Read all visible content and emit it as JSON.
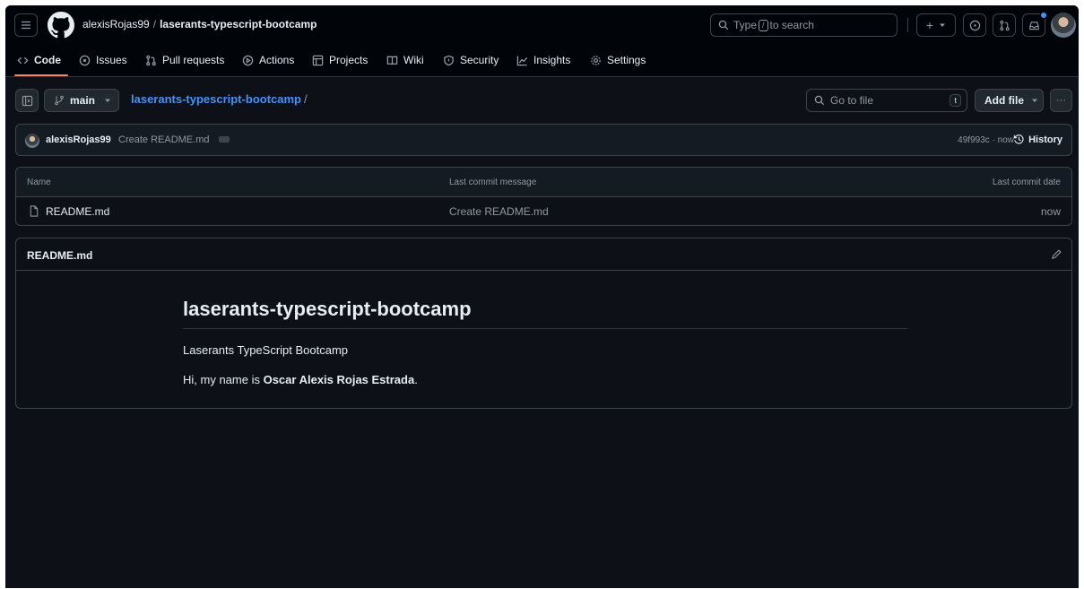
{
  "header": {
    "owner": "alexisRojas99",
    "separator": "/",
    "repo": "laserants-typescript-bootcamp",
    "search": {
      "before": "Type",
      "key": "/",
      "after": "to search"
    },
    "plus_label": "+"
  },
  "tabs": [
    {
      "id": "code",
      "label": "Code",
      "icon": "code-icon"
    },
    {
      "id": "issues",
      "label": "Issues",
      "icon": "issue-opened-icon"
    },
    {
      "id": "pulls",
      "label": "Pull requests",
      "icon": "git-pull-request-icon"
    },
    {
      "id": "actions",
      "label": "Actions",
      "icon": "play-icon"
    },
    {
      "id": "projects",
      "label": "Projects",
      "icon": "table-icon"
    },
    {
      "id": "wiki",
      "label": "Wiki",
      "icon": "book-icon"
    },
    {
      "id": "security",
      "label": "Security",
      "icon": "shield-icon"
    },
    {
      "id": "insights",
      "label": "Insights",
      "icon": "graph-icon"
    },
    {
      "id": "settings",
      "label": "Settings",
      "icon": "gear-icon"
    }
  ],
  "toolbar": {
    "branch": "main",
    "path_repo": "laserants-typescript-bootcamp",
    "path_slash": "/",
    "goto_placeholder": "Go to file",
    "goto_shortcut": "t",
    "add_file": "Add file",
    "more": "···"
  },
  "commit": {
    "author": "alexisRojas99",
    "message": "Create README.md",
    "hash_time": "49f993c · now",
    "history": "History"
  },
  "files": {
    "headers": {
      "name": "Name",
      "message": "Last commit message",
      "date": "Last commit date"
    },
    "rows": [
      {
        "name": "README.md",
        "message": "Create README.md",
        "date": "now"
      }
    ]
  },
  "readme": {
    "title": "README.md",
    "h1": "laserants-typescript-bootcamp",
    "p1": "Laserants TypeScript Bootcamp",
    "p2_prefix": "Hi, my name is",
    "p2_bold": "Oscar Alexis Rojas Estrada",
    "p2_suffix": "."
  },
  "colors": {
    "bg": "#0d1117",
    "header_bg": "#010409",
    "border": "#3d444d",
    "link": "#4493f8",
    "tab_underline": "#f78166"
  }
}
